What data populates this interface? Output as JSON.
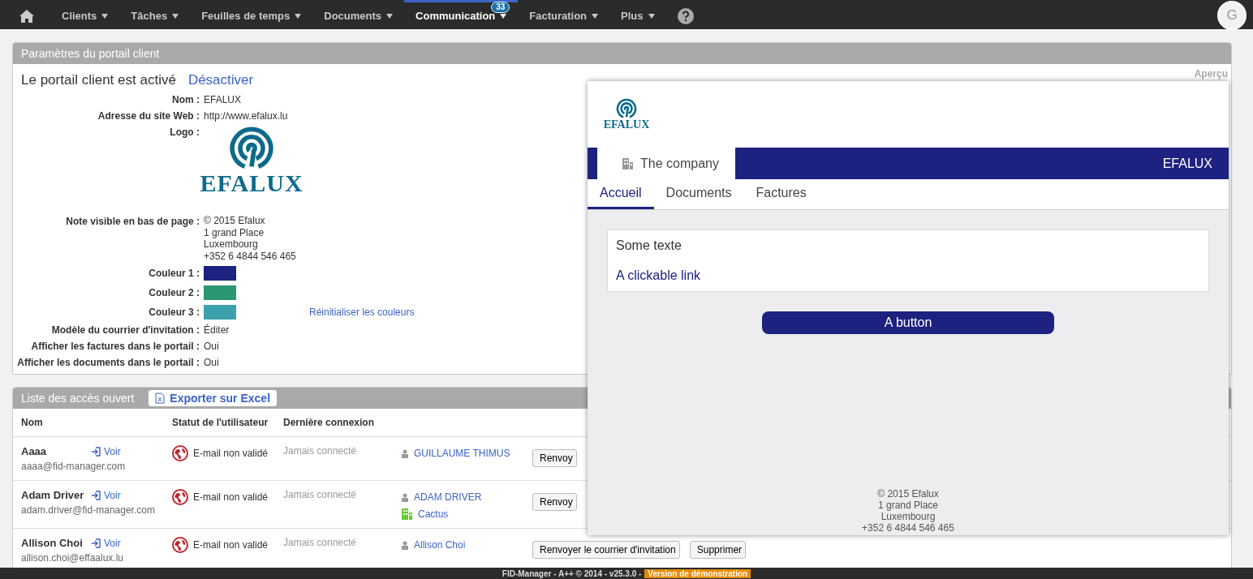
{
  "nav": {
    "items": [
      {
        "label": "Clients",
        "selected": false
      },
      {
        "label": "Tâches",
        "selected": false
      },
      {
        "label": "Feuilles de temps",
        "selected": false
      },
      {
        "label": "Documents",
        "selected": false
      },
      {
        "label": "Communication",
        "selected": true,
        "badge": "33"
      },
      {
        "label": "Facturation",
        "selected": false
      },
      {
        "label": "Plus",
        "selected": false
      }
    ],
    "avatar": "G"
  },
  "portal_settings": {
    "title": "Paramètres du portail client",
    "status_text": "Le portail client est activé",
    "deactivate_link": "Désactiver",
    "fields": [
      {
        "kind": "text",
        "label": "Nom :",
        "value": "EFALUX"
      },
      {
        "kind": "text",
        "label": "Adresse du site Web :",
        "value": "http://www.efalux.lu"
      },
      {
        "kind": "logo",
        "label": "Logo :",
        "logo_text": "EFALUX"
      },
      {
        "kind": "multiline",
        "label": "Note visible en bas de page :",
        "lines": [
          "© 2015 Efalux",
          "1 grand Place",
          "Luxembourg",
          "+352 6 4844 546 465"
        ]
      },
      {
        "kind": "color",
        "label": "Couleur 1 :",
        "color": "#1d2180"
      },
      {
        "kind": "color",
        "label": "Couleur 2 :",
        "color": "#2b9574"
      },
      {
        "kind": "color",
        "label": "Couleur 3 :",
        "color": "#3aa1ad",
        "link": "Réinitialiser les couleurs"
      },
      {
        "kind": "text",
        "label": "Modèle du courrier d'invitation :",
        "value": "Éditer"
      },
      {
        "kind": "text",
        "label": "Afficher les factures dans le portail :",
        "value": "Oui"
      },
      {
        "kind": "text",
        "label": "Afficher les documents dans le portail :",
        "value": "Oui"
      }
    ]
  },
  "access_list": {
    "title": "Liste des accès ouvert",
    "export_button": "Exporter sur Excel",
    "columns": [
      "Nom",
      "Statut de l'utilisateur",
      "Dernière connexion"
    ],
    "rows": [
      {
        "name": "Aaaa",
        "view_link": "Voir",
        "email": "aaaa@fid-manager.com",
        "status": "E-mail non validé",
        "last_login": "Jamais connecté",
        "contacts": [
          {
            "kind": "person",
            "name": "GUILLAUME THIMUS"
          }
        ],
        "actions": [
          "Renvoy"
        ]
      },
      {
        "name": "Adam Driver",
        "view_link": "Voir",
        "email": "adam.driver@fid-manager.com",
        "status": "E-mail non validé",
        "last_login": "Jamais connecté",
        "contacts": [
          {
            "kind": "person",
            "name": "ADAM DRIVER"
          },
          {
            "kind": "company",
            "name": "Cactus"
          }
        ],
        "actions": [
          "Renvoy"
        ]
      },
      {
        "name": "Allison Choi",
        "view_link": "Voir",
        "email": "allison.choi@effaalux.lu",
        "status": "E-mail non validé",
        "last_login": "Jamais connecté",
        "contacts": [
          {
            "kind": "person",
            "name": "Allison Choi"
          }
        ],
        "actions": [
          "Renvoyer le courrier d'invitation",
          "Supprimer"
        ]
      }
    ]
  },
  "preview": {
    "label": "Aperçu",
    "logo_text": "EFALUX",
    "company_tab": "The company",
    "brand": "EFALUX",
    "tabs": [
      {
        "label": "Accueil",
        "selected": true
      },
      {
        "label": "Documents",
        "selected": false
      },
      {
        "label": "Factures",
        "selected": false
      }
    ],
    "card_text": "Some texte",
    "card_link": "A clickable link",
    "button": "A button",
    "footer_lines": [
      "© 2015 Efalux",
      "1 grand Place",
      "Luxembourg",
      "+352 6 4844 546 465"
    ]
  },
  "footer": {
    "text": "FID-Manager - A++ © 2014 - v25.3.0 -",
    "badge": "Version de démonstration"
  }
}
